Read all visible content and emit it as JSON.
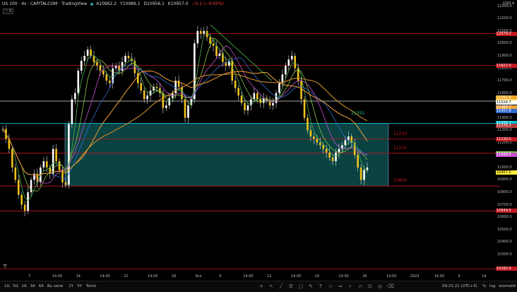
{
  "header": {
    "symbol": "US 100 · 4s · CAPITALCOM · TradingView",
    "o": "A10962.2",
    "h": "Y10986.1",
    "l": "D10956.1",
    "c": "K10957.0",
    "change": "−5.1 (−0.05%)",
    "collapse": "⌃ 3"
  },
  "currency": "USD ▾",
  "y_axis": {
    "ticks": [
      "12300.0",
      "12200.0",
      "12100.0",
      "12000.0",
      "11900.0",
      "11800.0",
      "11700.0",
      "11600.0",
      "11500.0",
      "11400.0",
      "11300.0",
      "11200.0",
      "11100.0",
      "11000.0",
      "10900.0",
      "10800.0",
      "10700.0",
      "10600.0",
      "10500.0",
      "10400.0",
      "10300.0"
    ],
    "tags": [
      {
        "text": "12079.0",
        "bg": "#c0171f"
      },
      {
        "text": "11822.0",
        "bg": "#c0171f"
      },
      {
        "text": "11561.8",
        "bg": "#f5a623"
      },
      {
        "text": "11535.0",
        "bg": "#ffd54f"
      },
      {
        "text": "11524.7",
        "bg": "#ffffff",
        "fg": "#000"
      },
      {
        "text": "11485.7",
        "bg": "#f6a33a"
      },
      {
        "text": "11457.8",
        "bg": "#2f6bd0"
      },
      {
        "text": "11355.7",
        "bg": "#00bcd4"
      },
      {
        "text": "11376.3",
        "bg": "#b13b3b"
      },
      {
        "text": "11230.0",
        "bg": "#c0171f"
      },
      {
        "text": "11113.5",
        "bg": "#76c442"
      },
      {
        "text": "11099.4",
        "bg": "#c74fd1"
      },
      {
        "text": "10957.0",
        "bg": "#ffeb3b",
        "fg": "#000"
      },
      {
        "text": "10649.0",
        "bg": "#c0171f"
      },
      {
        "text": "10182.9",
        "bg": "#c0171f"
      }
    ]
  },
  "x_axis": {
    "labels": [
      "7",
      "14:00",
      "14",
      "14:00",
      "21",
      "14:00",
      "28",
      "Ara",
      "6",
      "14:00",
      "12",
      "14:00",
      "19",
      "14:00",
      "26",
      "14:00",
      "2023",
      "14:00",
      "9",
      "14"
    ]
  },
  "annotations": {
    "level_11355": "11355",
    "level_11230": "11230",
    "level_11115": "11115",
    "level_10850": "10850"
  },
  "bottom_bar": {
    "timeframes": [
      "1G",
      "5G",
      "1A",
      "3A",
      "6A",
      "Bu sene",
      "1Y",
      "5Y",
      "Tümü"
    ],
    "time": "09:21:21 (UTC+3)",
    "pct": "%",
    "log": "log",
    "auto": "otomatik"
  },
  "chart_data": {
    "type": "candlestick",
    "title": "US 100 · 4s · CAPITALCOM",
    "ylim": [
      10150,
      12350
    ],
    "horizontal_levels": [
      12079.0,
      11822.0,
      11535.0,
      11355.7,
      11230.0,
      11115.0,
      10850.0,
      10649.0,
      10182.9
    ],
    "zone": {
      "top": 11355.7,
      "bottom": 10850.0
    },
    "trendline": {
      "from": 12150,
      "to": 11700
    },
    "close_path": [
      11310,
      11230,
      11150,
      11000,
      10900,
      10780,
      10700,
      10650,
      10800,
      10900,
      10950,
      10880,
      11000,
      11050,
      11000,
      10950,
      11150,
      11050,
      10980,
      10880,
      10860,
      11350,
      11550,
      11600,
      11780,
      11860,
      11900,
      11950,
      11900,
      11850,
      11820,
      11780,
      11750,
      11700,
      11680,
      11800,
      11820,
      11780,
      11850,
      11900,
      11880,
      11860,
      11760,
      11680,
      11620,
      11550,
      11580,
      11620,
      11650,
      11640,
      11600,
      11480,
      11500,
      11560,
      11600,
      11700,
      11650,
      11550,
      11400,
      11500,
      11550,
      12000,
      12100,
      12080,
      12100,
      12050,
      12000,
      11980,
      11900,
      11920,
      11850,
      11820,
      11860,
      11700,
      11640,
      11580,
      11520,
      11460,
      11500,
      11550,
      11600,
      11550,
      11520,
      11560,
      11540,
      11500,
      11520,
      11600,
      11680,
      11750,
      11820,
      11870,
      11900,
      11800,
      11700,
      11550,
      11400,
      11300,
      11250,
      11230,
      11200,
      11180,
      11150,
      11120,
      11080,
      11050,
      11120,
      11150,
      11180,
      11220,
      11250,
      11200,
      11100,
      11000,
      10900,
      10980,
      11000
    ]
  }
}
